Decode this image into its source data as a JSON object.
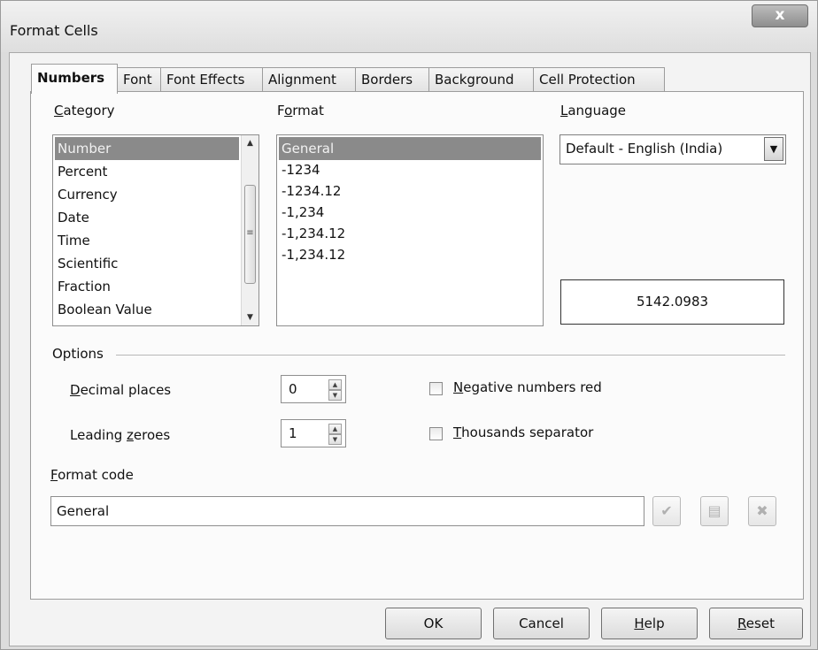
{
  "window": {
    "title": "Format Cells",
    "close_glyph": "x"
  },
  "tabs": [
    {
      "label": "Numbers",
      "active": true
    },
    {
      "label": "Font"
    },
    {
      "label": "Font Effects"
    },
    {
      "label": "Alignment"
    },
    {
      "label": "Borders"
    },
    {
      "label": "Background"
    },
    {
      "label": "Cell Protection"
    }
  ],
  "category": {
    "label_key": "C",
    "label_rest": "ategory",
    "selected": "Number",
    "items": [
      "Number",
      "Percent",
      "Currency",
      "Date",
      "Time",
      "Scientific",
      "Fraction",
      "Boolean Value"
    ]
  },
  "format": {
    "label_first": "F",
    "label_key": "o",
    "label_rest": "rmat",
    "selected": "General",
    "items": [
      "General",
      "-1234",
      "-1234.12",
      "-1,234",
      "-1,234.12",
      "-1,234.12"
    ]
  },
  "language": {
    "label_key": "L",
    "label_rest": "anguage",
    "value": "Default - English (India)"
  },
  "preview": {
    "value": "5142.0983"
  },
  "options": {
    "label": "Options",
    "decimal_places": {
      "label_key": "D",
      "label_rest": "ecimal places",
      "value": "0"
    },
    "leading_zeroes": {
      "label_pre": "Leading ",
      "label_key": "z",
      "label_rest": "eroes",
      "value": "1"
    },
    "negative_red": {
      "label_key": "N",
      "label_rest": "egative numbers red",
      "checked": false
    },
    "thousands_separator": {
      "label_key": "T",
      "label_rest": "housands separator",
      "checked": false
    }
  },
  "format_code": {
    "label_key": "F",
    "label_rest": "ormat code",
    "value": "General"
  },
  "code_buttons": {
    "add_icon": "✔",
    "comment_icon": "▤",
    "delete_icon": "✖"
  },
  "buttons": {
    "ok": "OK",
    "cancel": "Cancel",
    "help_key": "H",
    "help_rest": "elp",
    "reset_key": "R",
    "reset_rest": "eset"
  },
  "icons": {
    "scroll_up": "▲",
    "scroll_down": "▼",
    "scroll_grip": "≡",
    "dropdown": "▼",
    "spin_up": "▲",
    "spin_down": "▼"
  }
}
